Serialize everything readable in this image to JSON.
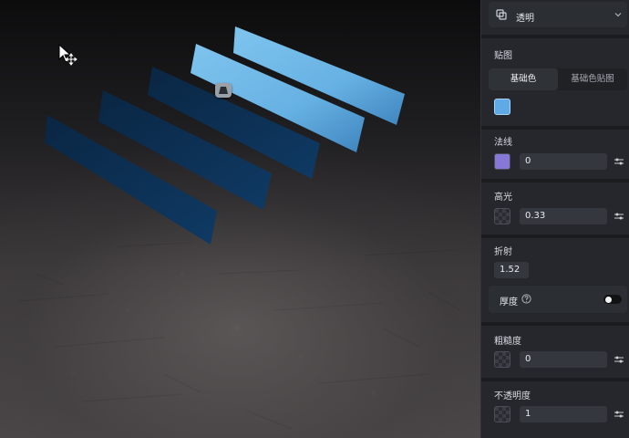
{
  "panel": {
    "mode_label": "透明",
    "texture_section_label": "贴图",
    "tabs": [
      {
        "label": "基础色",
        "active": true
      },
      {
        "label": "基础色贴图",
        "active": false
      }
    ],
    "base_color": "#5ea9e6",
    "normal": {
      "label": "法线",
      "swatch_color": "#8778d8",
      "value": "0"
    },
    "specular": {
      "label": "高光",
      "value": "0.33"
    },
    "refraction": {
      "label": "折射",
      "value": "1.52"
    },
    "thickness": {
      "label": "厚度",
      "enabled": false
    },
    "roughness": {
      "label": "粗糙度",
      "value": "0"
    },
    "opacity": {
      "label": "不透明度",
      "value": "1"
    }
  },
  "viewport": {
    "colors": {
      "light_panel": "#6bb7e6",
      "dark_panel": "#0c2c4e",
      "handle": "#9aa0a8"
    },
    "icons": [
      "move-cursor-icon",
      "anchor-handle-icon"
    ]
  }
}
